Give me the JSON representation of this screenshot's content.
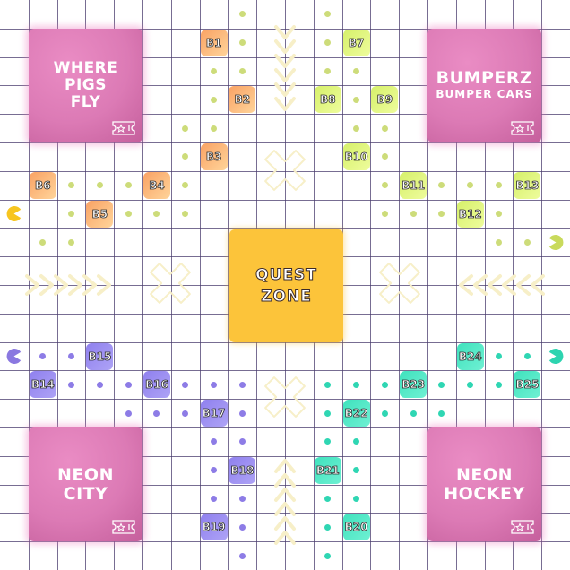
{
  "attractions": [
    {
      "name": "WHERE\nPIGS\nFLY",
      "sub": "",
      "icon": "ticket-star-icon"
    },
    {
      "name": "BUMPERZ",
      "sub": "BUMPER CARS",
      "icon": "ticket-star-icon"
    },
    {
      "name": "NEON\nCITY",
      "sub": "",
      "icon": "ticket-star-icon"
    },
    {
      "name": "NEON\nHOCKEY",
      "sub": "",
      "icon": "ticket-star-icon"
    }
  ],
  "quest_zone": {
    "line1": "QUEST",
    "line2": "ZONE"
  },
  "tiles": [
    "B1",
    "B2",
    "B3",
    "B4",
    "B5",
    "B6",
    "B7",
    "B8",
    "B9",
    "B10",
    "B11",
    "B12",
    "B13",
    "B14",
    "B15",
    "B16",
    "B17",
    "B18",
    "B19",
    "B20",
    "B21",
    "B22",
    "B23",
    "B24",
    "B25"
  ],
  "colors": {
    "orange": "#fbb47a",
    "lime": "#e0f77e",
    "purple": "#9d90f2",
    "teal": "#52e8c6",
    "dot_lime": "#cddc7a",
    "dot_purple": "#8d7ce6",
    "dot_teal": "#2fd6b3",
    "pac_yellow": "#f7c51f",
    "pac_lime": "#c9da5c",
    "pac_purple": "#8a78e0",
    "pac_teal": "#2dd4b0",
    "attraction": "#dc7ab5",
    "quest": "#fcc43a",
    "grid": "#4a3c6e",
    "decor": "#f7efc8"
  }
}
